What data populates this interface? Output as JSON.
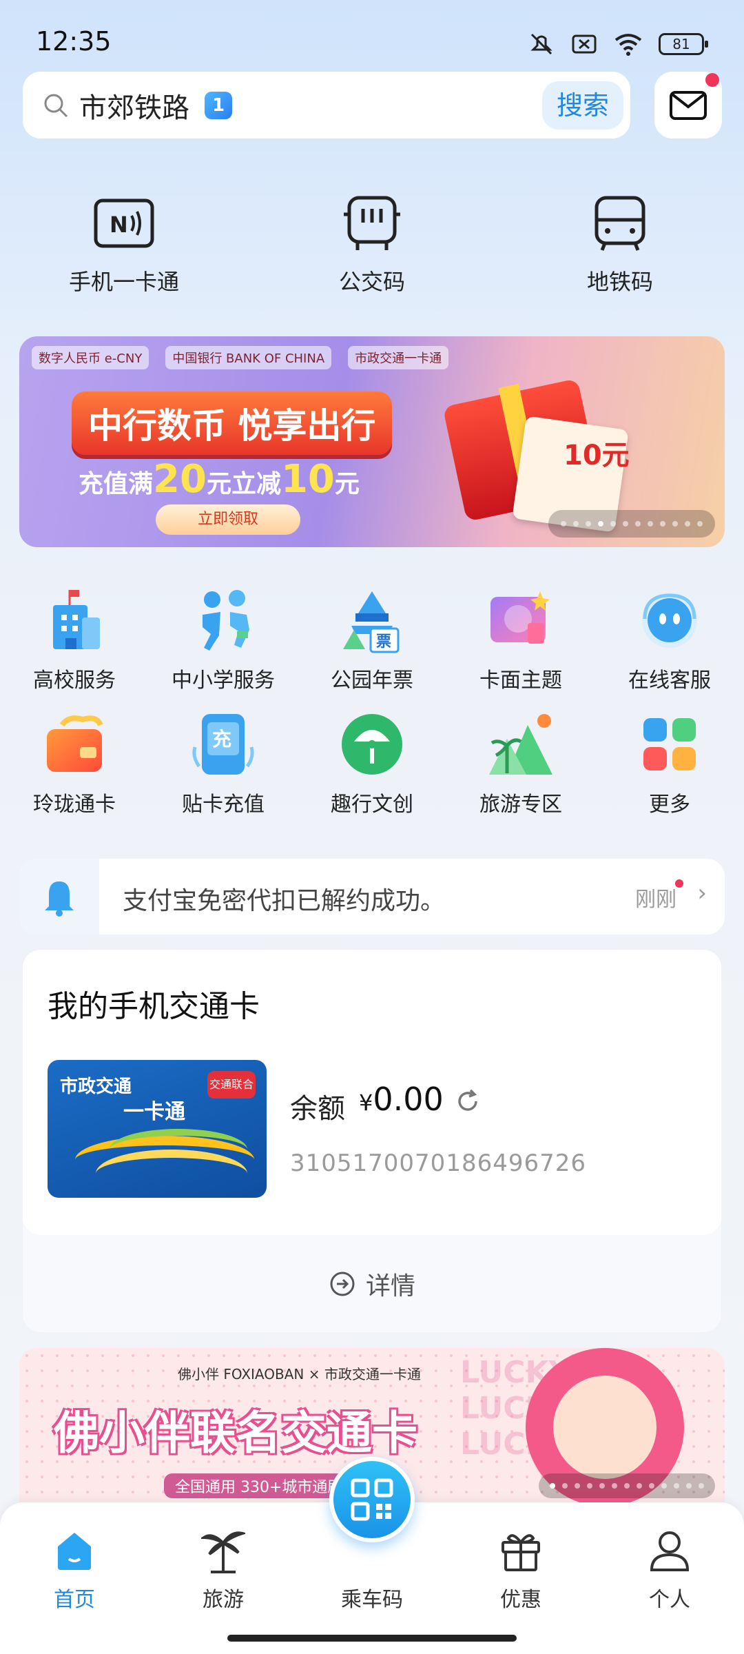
{
  "status_bar": {
    "time": "12:35",
    "battery": "81"
  },
  "search": {
    "text": "市郊铁路",
    "badge": "1",
    "button": "搜索"
  },
  "quick_access": [
    {
      "label": "手机一卡通",
      "icon": "nfc-card-icon"
    },
    {
      "label": "公交码",
      "icon": "bus-icon"
    },
    {
      "label": "地铁码",
      "icon": "subway-icon"
    }
  ],
  "banner": {
    "logos": [
      "数字人民币 e-CNY",
      "中国银行 BANK OF CHINA",
      "市政交通一卡通"
    ],
    "title": "中行数币 悦享出行",
    "sub_prefix": "充值满",
    "sub_amount1": "20",
    "sub_mid": "元立减",
    "sub_amount2": "10",
    "sub_suffix": "元",
    "cta": "立即领取",
    "envelope": "10元"
  },
  "services": [
    {
      "label": "高校服务",
      "icon": "university-icon"
    },
    {
      "label": "中小学服务",
      "icon": "students-icon"
    },
    {
      "label": "公园年票",
      "icon": "park-ticket-icon"
    },
    {
      "label": "卡面主题",
      "icon": "card-theme-icon"
    },
    {
      "label": "在线客服",
      "icon": "customer-service-icon"
    },
    {
      "label": "玲珑通卡",
      "icon": "linglong-card-icon"
    },
    {
      "label": "贴卡充值",
      "icon": "card-recharge-icon"
    },
    {
      "label": "趣行文创",
      "icon": "creative-icon"
    },
    {
      "label": "旅游专区",
      "icon": "travel-zone-icon"
    },
    {
      "label": "更多",
      "icon": "more-grid-icon"
    }
  ],
  "notice": {
    "text": "支付宝免密代扣已解约成功。",
    "time": "刚刚"
  },
  "my_card": {
    "title": "我的手机交通卡",
    "card_logo": "市政交通",
    "card_logo2": "一卡通",
    "card_badge": "交通联合",
    "balance_label": "余额",
    "currency": "¥",
    "balance": "0.00",
    "card_number": "3105170070186496726",
    "details": "详情"
  },
  "promo": {
    "header": "佛小伴 FOXIAOBAN × 市政交通一卡通",
    "title": "佛小伴联名交通卡",
    "sub": "全国通用 330+城市通刷",
    "lucky": "LUCKY"
  },
  "nav": {
    "home": "首页",
    "travel": "旅游",
    "ride_code": "乘车码",
    "offers": "优惠",
    "profile": "个人"
  },
  "colors": {
    "accent": "#1e88e5",
    "notification": "#f0345a"
  }
}
